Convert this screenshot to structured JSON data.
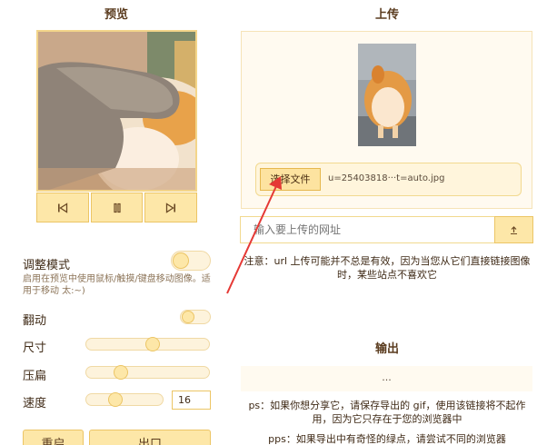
{
  "preview": {
    "title": "预览",
    "controls": [
      "skip-back-icon",
      "pause-icon",
      "skip-forward-icon"
    ]
  },
  "settings": {
    "adjust_mode_label": "调整模式",
    "adjust_mode_hint": "启用在预览中使用鼠标/触摸/键盘移动图像。适用于移动 太:~)",
    "adjust_mode_on": false,
    "flip_label": "翻动",
    "flip_on": false,
    "size_label": "尺寸",
    "size_value": 0.55,
    "squash_label": "压扁",
    "squash_value": 0.25,
    "speed_label": "速度",
    "speed_value": 16
  },
  "buttons": {
    "reset": "重启",
    "export": "出口"
  },
  "upload": {
    "title": "上传",
    "choose_file": "选择文件",
    "file_name": "u=25403818···t=auto.jpg",
    "url_placeholder": "输入要上传的网址",
    "upload_icon": "upload-icon",
    "note": "注意：url 上传可能并不总是有效，因为当您从它们直接链接图像时，某些站点不喜欢它"
  },
  "output": {
    "title": "输出",
    "value": "...",
    "ps": "ps：如果你想分享它，请保存导出的 gif，使用该链接将不起作用，因为它只存在于您的浏览器中",
    "pps": "pps：如果导出中有奇怪的绿点，请尝试不同的浏览器"
  },
  "colors": {
    "accent": "#fde7a8",
    "accent_border": "#ecc565",
    "annotation_arrow": "#e53935"
  }
}
